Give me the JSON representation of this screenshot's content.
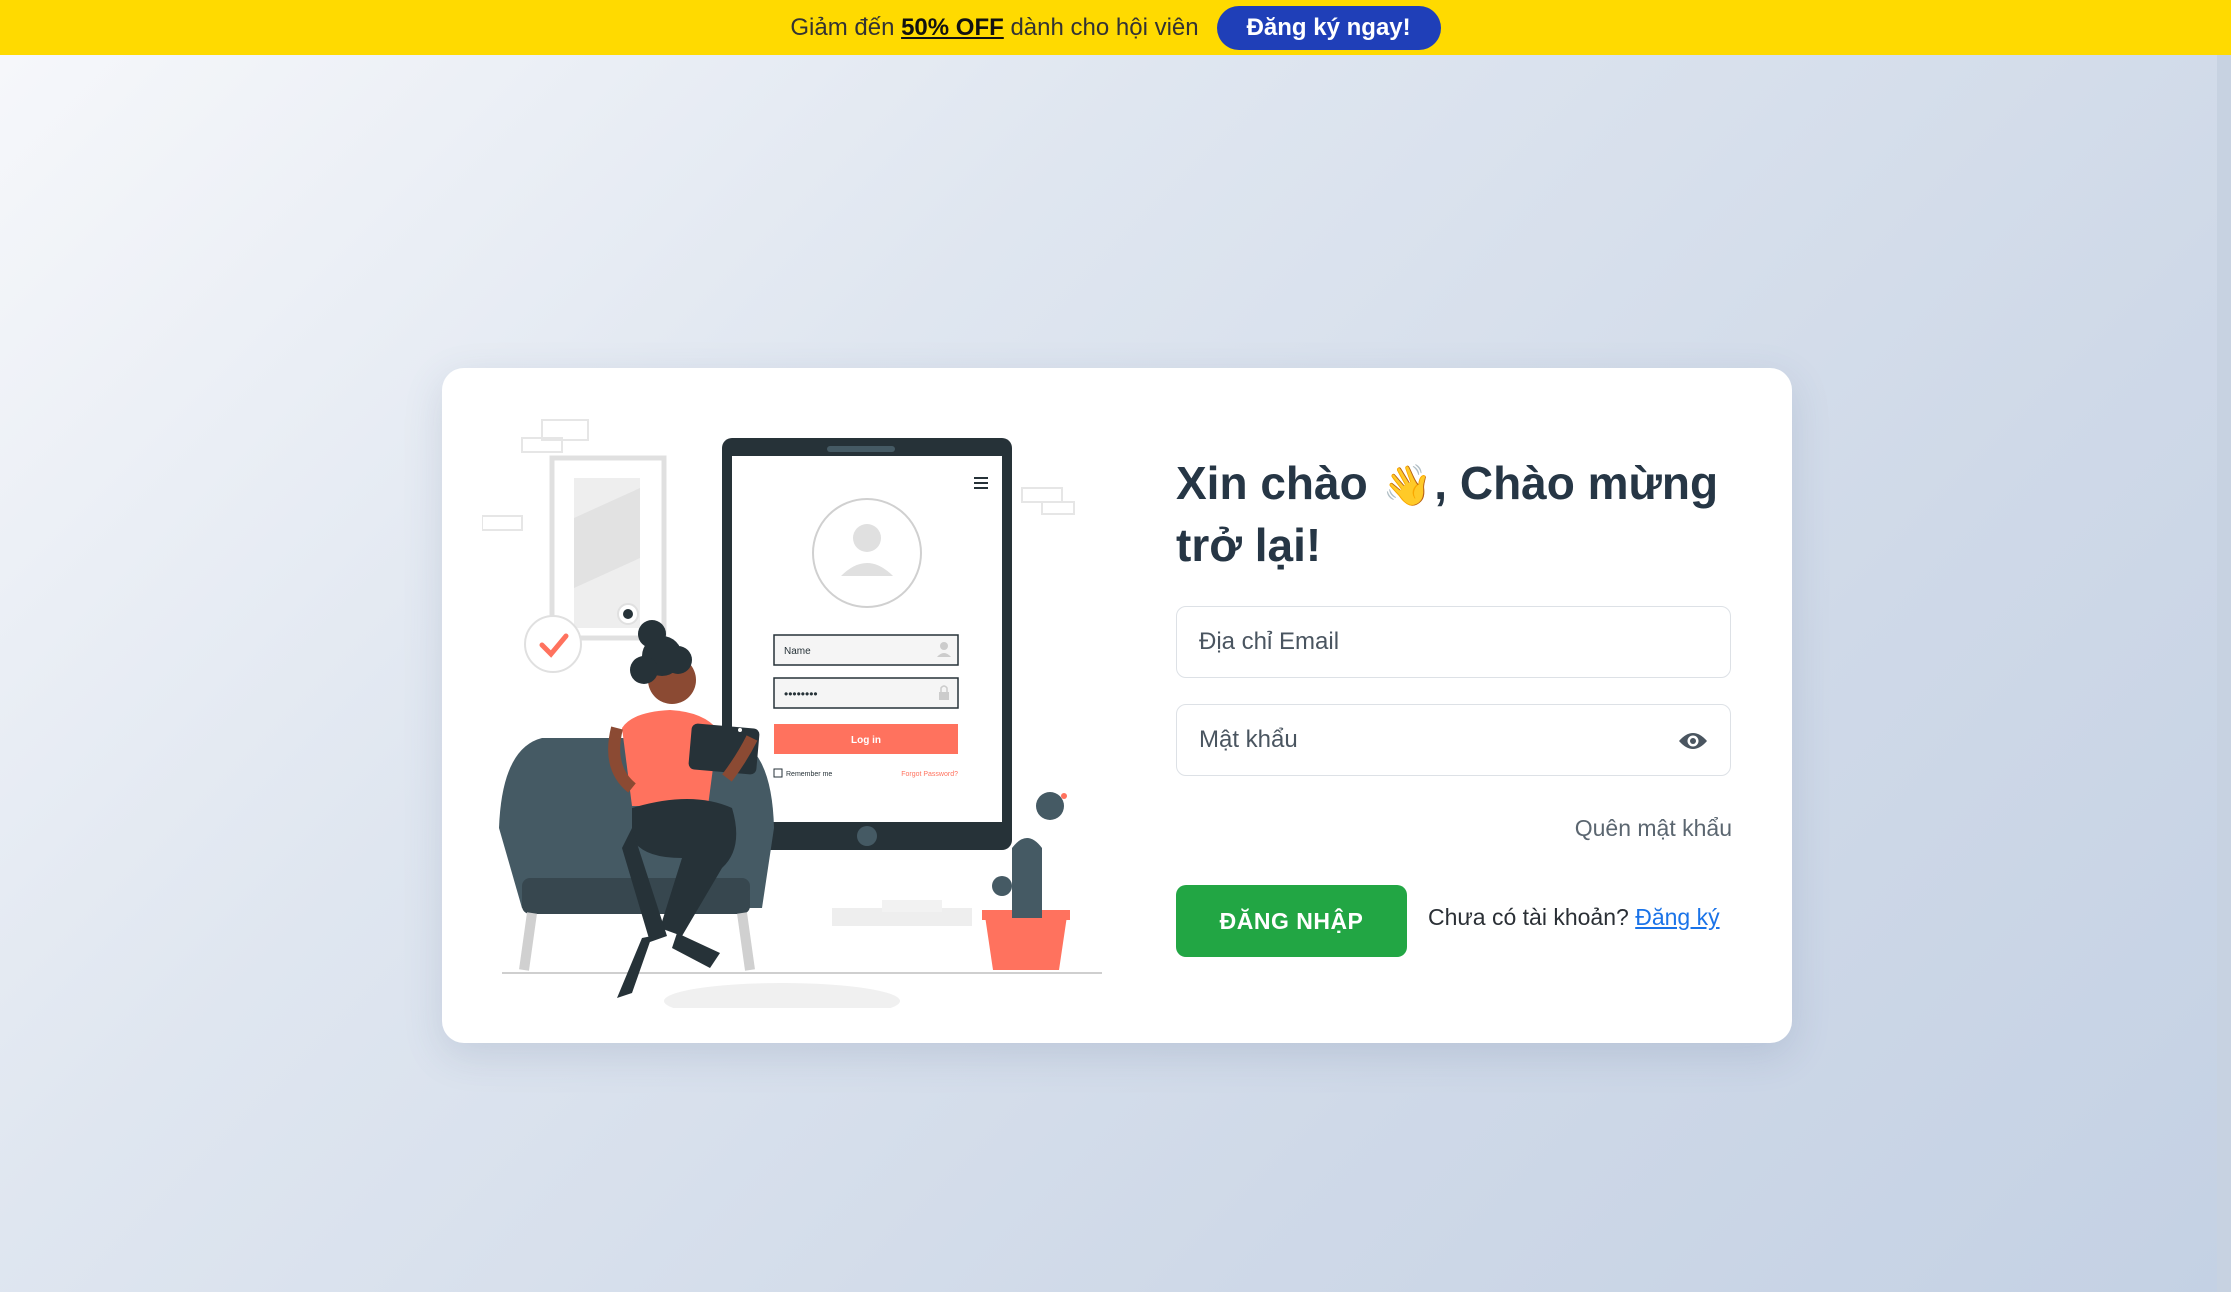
{
  "promo": {
    "prefix": "Giảm đến ",
    "highlight": "50% OFF",
    "suffix": " dành cho hội viên",
    "button_label": "Đăng ký ngay!"
  },
  "login": {
    "title_part1": "Xin chào ",
    "title_emoji": "👋",
    "title_part2": ", Chào mừng trở lại!",
    "email_placeholder": "Địa chỉ Email",
    "password_placeholder": "Mật khẩu",
    "forgot_label": "Quên mật khẩu",
    "submit_label": "ĐĂNG NHẬP",
    "no_account_text": "Chưa có tài khoản? ",
    "signup_label": "Đăng ký"
  },
  "illustration_mockup": {
    "name_label": "Name",
    "password_dots": "••••••••",
    "login_button": "Log in",
    "remember_label": "Remember me",
    "forgot_label": "Forgot Password?"
  },
  "colors": {
    "promo_bg": "#ffda00",
    "promo_button": "#1f3fb8",
    "submit_button": "#22a644",
    "title": "#263645",
    "link": "#1a73e8",
    "accent_coral": "#ff725e"
  },
  "icons": [
    "waving-hand-icon",
    "eye-icon",
    "hamburger-menu-icon",
    "check-icon",
    "user-avatar-icon",
    "lock-icon"
  ]
}
